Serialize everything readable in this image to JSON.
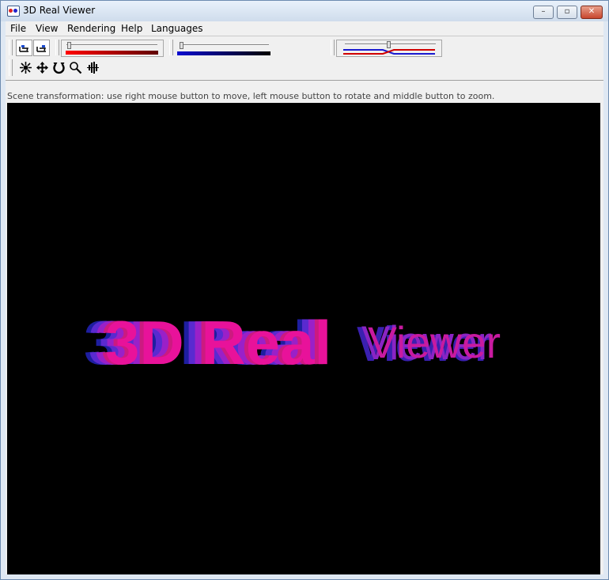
{
  "window": {
    "title": "3D Real Viewer"
  },
  "titlebar_buttons": {
    "minimize": "–",
    "maximize": "▫",
    "close": "✕"
  },
  "menu": [
    "File",
    "View",
    "Rendering",
    "Help",
    "Languages"
  ],
  "toolbar": {
    "row1_buttons": [
      "anaglyph-mode-1-icon",
      "anaglyph-mode-2-icon"
    ],
    "row2_buttons": [
      "rotate-tool-icon",
      "move-tool-icon",
      "rotate-arrow-icon",
      "zoom-icon",
      "waveform-icon"
    ]
  },
  "status_text": "Scene transformation: use right mouse button to move, left mouse button to rotate and middle button to zoom.",
  "scene": {
    "text_part1": "3D Real",
    "text_part2": "Viewer"
  },
  "colors": {
    "left_eye": "#ff0000",
    "right_eye": "#2a2aff",
    "background": "#000000"
  }
}
